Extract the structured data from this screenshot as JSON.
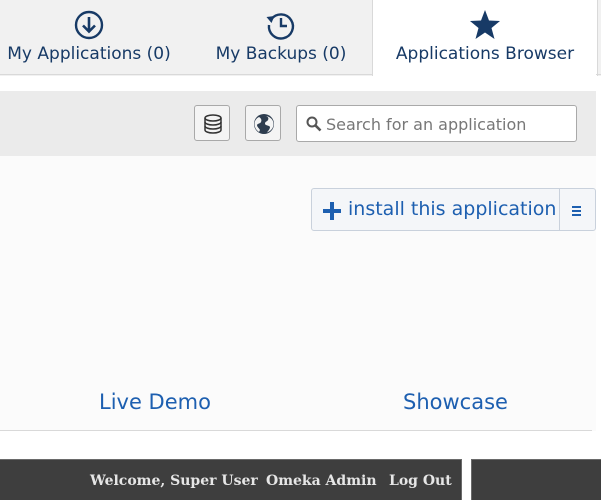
{
  "tabs": [
    {
      "label": "My Applications (0)",
      "icon": "download-circle-icon"
    },
    {
      "label": "My Backups (0)",
      "icon": "history-icon"
    },
    {
      "label": "Applications Browser",
      "icon": "star-icon"
    }
  ],
  "toolbar": {
    "db_button_icon": "database-icon",
    "globe_button_icon": "globe-icon",
    "search": {
      "placeholder": "Search for an application",
      "value": ""
    }
  },
  "install": {
    "label": "install this application",
    "menu_icon": "list-icon"
  },
  "links": {
    "live_demo": "Live Demo",
    "showcase": "Showcase"
  },
  "admin_bar": {
    "welcome": "Welcome, Super User",
    "omeka_admin": "Omeka Admin",
    "logout": "Log Out"
  },
  "colors": {
    "tab_text": "#173a66",
    "link": "#1d5fb0",
    "admin_bar_bg": "#3e3e3e",
    "toolbar_bg": "#ebebeb"
  }
}
